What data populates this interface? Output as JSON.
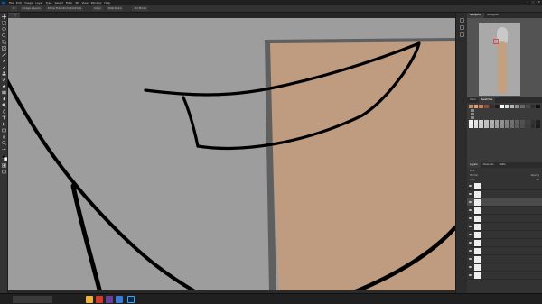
{
  "app": {
    "logo": "Ps",
    "menus": [
      "File",
      "Edit",
      "Image",
      "Layer",
      "Type",
      "Select",
      "Filter",
      "3D",
      "View",
      "Window",
      "Help"
    ],
    "window_controls": [
      "–",
      "□",
      "✕"
    ]
  },
  "options_bar": {
    "items": [
      "Image Layers",
      "Show Transform Controls"
    ],
    "align_labels": [
      "Align",
      "Distribute"
    ],
    "extra": [
      "3D Mode"
    ]
  },
  "document": {
    "tab_title": "",
    "tab_close": "×",
    "status_text": ""
  },
  "navigator": {
    "tabs": [
      "Navigator",
      "Histogram"
    ],
    "zoom": ""
  },
  "swatches": {
    "tabs": [
      "Color",
      "Swatches"
    ],
    "top_row_colors": [
      "#c98c6d",
      "#d9a07a",
      "#c47d56",
      "#8b4f3a",
      "#3e2b26",
      "#1a1a1a",
      "#ffffff",
      "#dcdcdc",
      "#b5b5b5",
      "#8f8f8f",
      "#6a6a6a",
      "#4a4a4a",
      "#2e2e2e",
      "#101010"
    ],
    "groups": [
      {
        "label": ""
      },
      {
        "label": ""
      },
      {
        "label": ""
      }
    ],
    "gray_rows": [
      [
        "#f2f2f2",
        "#e2e2e2",
        "#d2d2d2",
        "#c2c2c2",
        "#b2b2b2",
        "#a2a2a2",
        "#929292",
        "#828282",
        "#727272",
        "#626262",
        "#525252",
        "#424242",
        "#323232",
        "#222222"
      ],
      [
        "#ededed",
        "#dddddd",
        "#cdcdcd",
        "#bdbdbd",
        "#adadad",
        "#9d9d9d",
        "#8d8d8d",
        "#7d7d7d",
        "#6d6d6d",
        "#5d5d5d",
        "#4d4d4d",
        "#3d3d3d",
        "#2d2d2d",
        "#1d1d1d"
      ]
    ]
  },
  "layers": {
    "tabs": [
      "Layers",
      "Channels",
      "Paths"
    ],
    "kind_label": "Kind",
    "blend_mode": "Normal",
    "opacity_label": "Opacity",
    "lock_label": "Lock",
    "fill_label": "Fill",
    "items": [
      {
        "name": "",
        "selected": false
      },
      {
        "name": "",
        "selected": false
      },
      {
        "name": "",
        "selected": true
      },
      {
        "name": "",
        "selected": false
      },
      {
        "name": "",
        "selected": false
      },
      {
        "name": "",
        "selected": false
      },
      {
        "name": "",
        "selected": false
      },
      {
        "name": "",
        "selected": false
      },
      {
        "name": "",
        "selected": false
      },
      {
        "name": "",
        "selected": false
      },
      {
        "name": "",
        "selected": false
      },
      {
        "name": "",
        "selected": false
      }
    ]
  },
  "taskbar": {
    "search_placeholder": "",
    "time": "",
    "date": ""
  },
  "colors": {
    "canvas_gray": "#9d9d9d",
    "skin": "#bf9c80",
    "stroke": "#000000",
    "border": "#5a5a5a"
  }
}
